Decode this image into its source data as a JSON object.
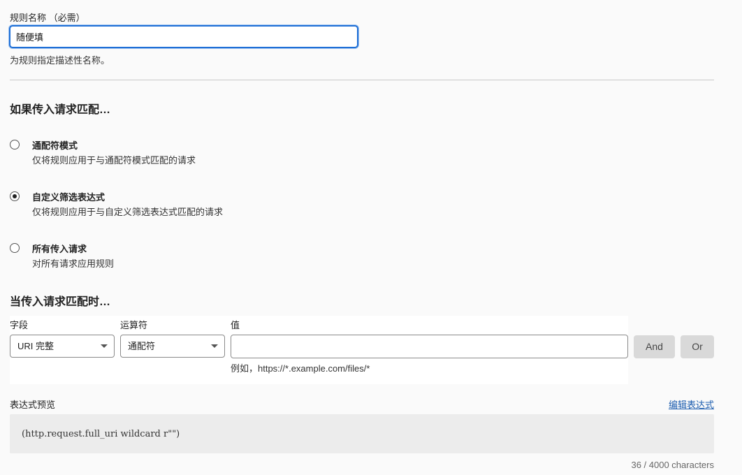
{
  "rule_name": {
    "label": "规则名称 （必需）",
    "value": "随便填",
    "help": "为规则指定描述性名称。"
  },
  "match_section": {
    "heading": "如果传入请求匹配…",
    "options": [
      {
        "title": "通配符模式",
        "description": "仅将规则应用于与通配符模式匹配的请求",
        "checked": false
      },
      {
        "title": "自定义筛选表达式",
        "description": "仅将规则应用于与自定义筛选表达式匹配的请求",
        "checked": true
      },
      {
        "title": "所有传入请求",
        "description": "对所有请求应用规则",
        "checked": false
      }
    ]
  },
  "condition_section": {
    "heading": "当传入请求匹配时…",
    "field_label": "字段",
    "field_value": "URI 完整",
    "operator_label": "运算符",
    "operator_value": "通配符",
    "value_label": "值",
    "value_value": "",
    "value_hint": "例如，https://*.example.com/files/*",
    "and_label": "And",
    "or_label": "Or"
  },
  "expression": {
    "label": "表达式预览",
    "edit_link": "编辑表达式",
    "preview": "(http.request.full_uri wildcard r\"\")",
    "counter": "36 / 4000 characters"
  },
  "colors": {
    "focus_border": "#1f6fd6",
    "link": "#1f5fb0",
    "button_bg": "#d9d9d9"
  }
}
